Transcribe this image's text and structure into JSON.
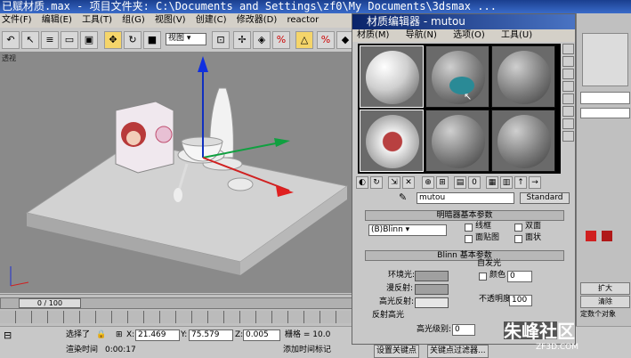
{
  "window": {
    "title": "已赋材质.max     - 项目文件夹: C:\\Documents and Settings\\zf0\\My Documents\\3dsmax ..."
  },
  "menubar": {
    "items": [
      "文件(F)",
      "编辑(E)",
      "工具(T)",
      "组(G)",
      "视图(V)",
      "创建(C)",
      "修改器(D)",
      "reactor"
    ]
  },
  "toolbar": {
    "view_dropdown": "视图"
  },
  "viewport": {
    "label": "透视"
  },
  "timeline": {
    "frame": "0 / 100"
  },
  "status": {
    "selection": "选择了",
    "x_label": "X:",
    "x_value": "21.469",
    "y_label": "Y:",
    "y_value": "75.579",
    "z_label": "Z:",
    "z_value": "0.005",
    "grid": "栅格 = 10.0",
    "render_time_label": "渲染时间",
    "render_time": "0:00:17",
    "add_time_tag": "添加时间标记",
    "set_key": "设置关键点",
    "key_filter": "关键点过滤器..."
  },
  "material_editor": {
    "title": "材质编辑器 - mutou",
    "menu": [
      "材质(M)",
      "导航(N)",
      "选项(O)",
      "工具(U)"
    ],
    "name_value": "mutou",
    "type_button": "Standard",
    "shader_rollout": "明暗器基本参数",
    "shader_value": "(B)Blinn",
    "wire": "线框",
    "two_sided": "双面",
    "face_map": "面贴图",
    "faceted": "面状",
    "blinn_rollout": "Blinn 基本参数",
    "self_illum": "自发光",
    "color": "颜色",
    "color_value": "0",
    "ambient": "环境光:",
    "diffuse": "漫反射:",
    "specular": "高光反射:",
    "opacity": "不透明度",
    "opacity_value": "100",
    "spec_highlights": "反射高光",
    "spec_level": "高光级别:",
    "spec_level_value": "0"
  },
  "right_panel": {
    "expand": "扩大",
    "clear": "清除",
    "fixed": "定数个对象"
  },
  "watermark": {
    "text": "朱峰社区",
    "sub": "ZF3D.COM"
  },
  "colors": {
    "title_bar": "#1a3f8f",
    "accent": "#0a246a",
    "viewport": "#8a8a8a"
  }
}
